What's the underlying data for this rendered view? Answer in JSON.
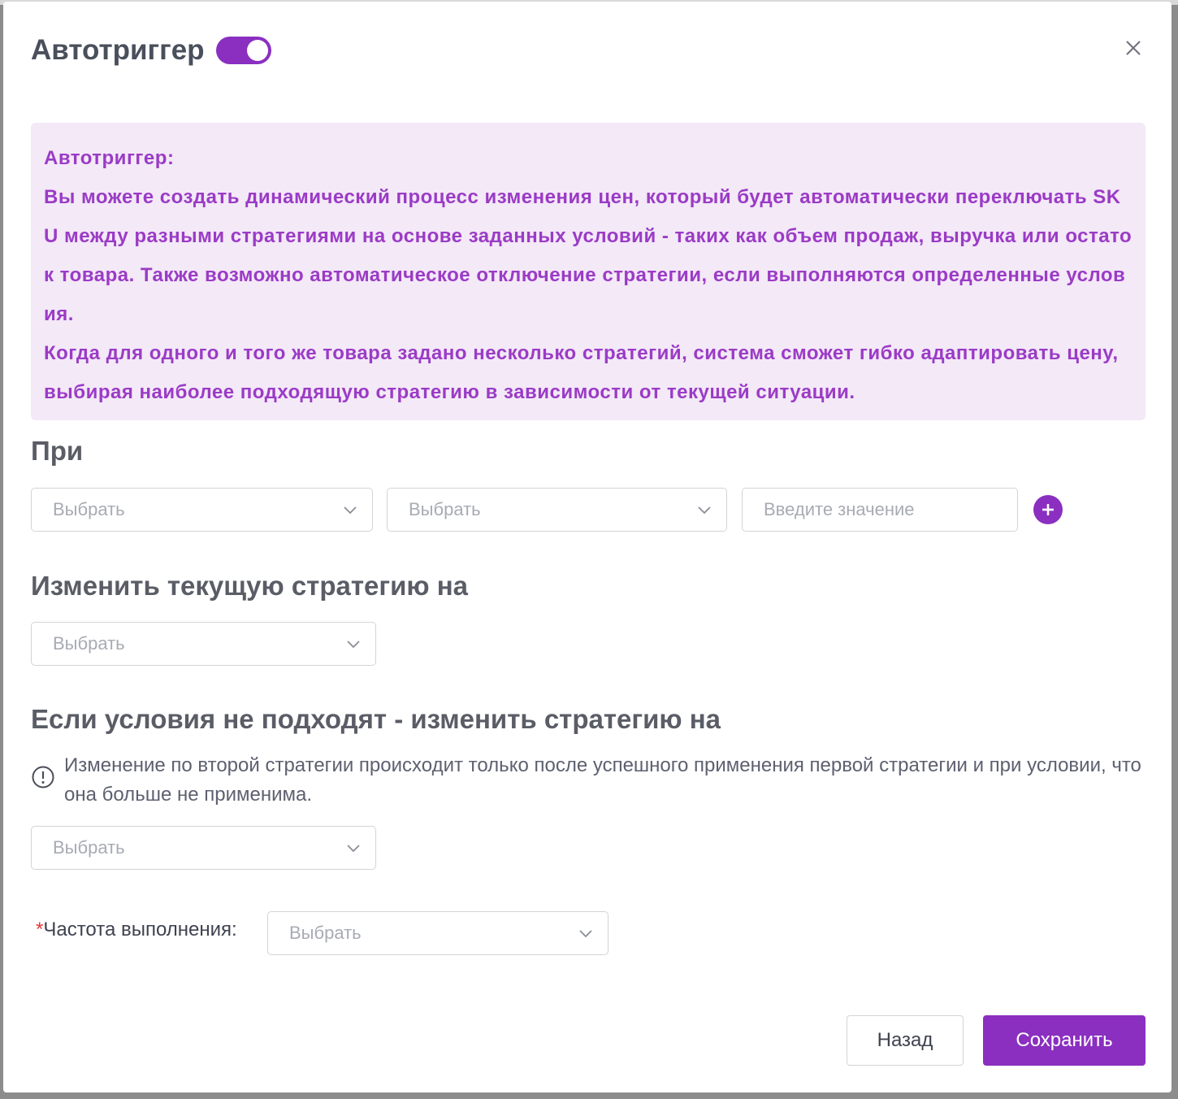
{
  "modal": {
    "title": "Автотриггер",
    "toggle_on": true,
    "close_icon": "close-icon"
  },
  "info": {
    "heading": "Автотриггер:",
    "paragraph1": "Вы можете создать динамический процесс изменения цен, который будет автоматически переключать SKU между разными стратегиями на основе заданных условий - таких как объем продаж, выручка или остаток товара. Также возможно автоматическое отключение стратегии, если выполняются определенные условия.",
    "paragraph2": "Когда для одного и того же товара задано несколько стратегий, система сможет гибко адаптировать цену, выбирая наиболее подходящую стратегию в зависимости от текущей ситуации."
  },
  "condition": {
    "title": "При",
    "select1_placeholder": "Выбрать",
    "select2_placeholder": "Выбрать",
    "value_placeholder": "Введите значение",
    "add_icon": "plus-circle-icon"
  },
  "change_strategy": {
    "title": "Изменить текущую стратегию на",
    "select_placeholder": "Выбрать"
  },
  "fallback": {
    "title": "Если условия не подходят - изменить стратегию на",
    "notice": "Изменение по второй стратегии происходит только после успешного применения первой стратегии и при условии, что она больше не применима.",
    "notice_icon": "exclamation-circle-icon",
    "select_placeholder": "Выбрать"
  },
  "frequency": {
    "required_mark": "*",
    "label": "Частота выполнения:",
    "select_placeholder": "Выбрать"
  },
  "footer": {
    "back_label": "Назад",
    "save_label": "Сохранить"
  },
  "colors": {
    "accent": "#8a2fc0",
    "info_bg": "#f3e9f7",
    "info_text": "#9b3bc6"
  }
}
